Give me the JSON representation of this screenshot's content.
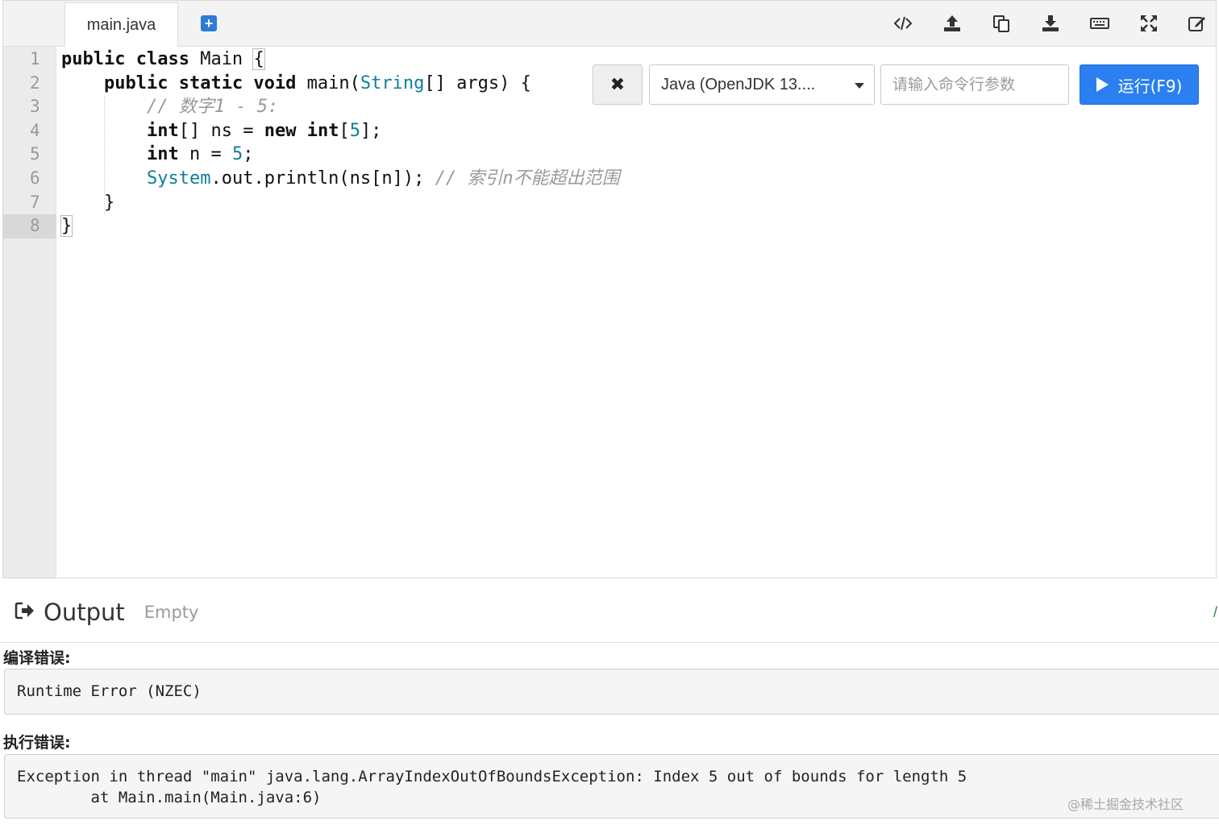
{
  "editor": {
    "tab_label": "main.java",
    "add_tab_symbol": "+",
    "line_numbers": [
      "1",
      "2",
      "3",
      "4",
      "5",
      "6",
      "7",
      "8"
    ],
    "code": {
      "l1_kw": "public class",
      "l1_name": " Main ",
      "l1_brace": "{",
      "l2_kw": "public static void",
      "l2_a": " main(",
      "l2_type": "String",
      "l2_b": "[] args) {",
      "l3_comment": "// 数字1 - 5:",
      "l4_kw1": "int",
      "l4_a": "[] ns = ",
      "l4_kw2": "new int",
      "l4_b": "[",
      "l4_num": "5",
      "l4_c": "];",
      "l5_kw": "int",
      "l5_a": " n = ",
      "l5_num": "5",
      "l5_b": ";",
      "l6_type": "System",
      "l6_a": ".out.println(ns[n]); ",
      "l6_comment": "// 索引n不能超出范围",
      "l7": "}",
      "l8": "}"
    }
  },
  "toolbar": {
    "icons": [
      "code-icon",
      "upload-icon",
      "copy-icon",
      "download-icon",
      "keyboard-icon",
      "fullscreen-icon",
      "edit-icon"
    ]
  },
  "run": {
    "clear_symbol": "✖",
    "language": "Java (OpenJDK 13....",
    "args_placeholder": "请输入命令行参数",
    "run_label": "运行(F9)"
  },
  "output": {
    "title": "Output",
    "status": "Empty",
    "compile_error_label": "编译错误:",
    "compile_error_text": "Runtime Error (NZEC)",
    "runtime_error_label": "执行错误:",
    "runtime_error_line1": "Exception in thread \"main\" java.lang.ArrayIndexOutOfBoundsException: Index 5 out of bounds for length 5",
    "runtime_error_line2": "        at Main.main(Main.java:6)"
  },
  "watermark": "@稀土掘金技术社区"
}
